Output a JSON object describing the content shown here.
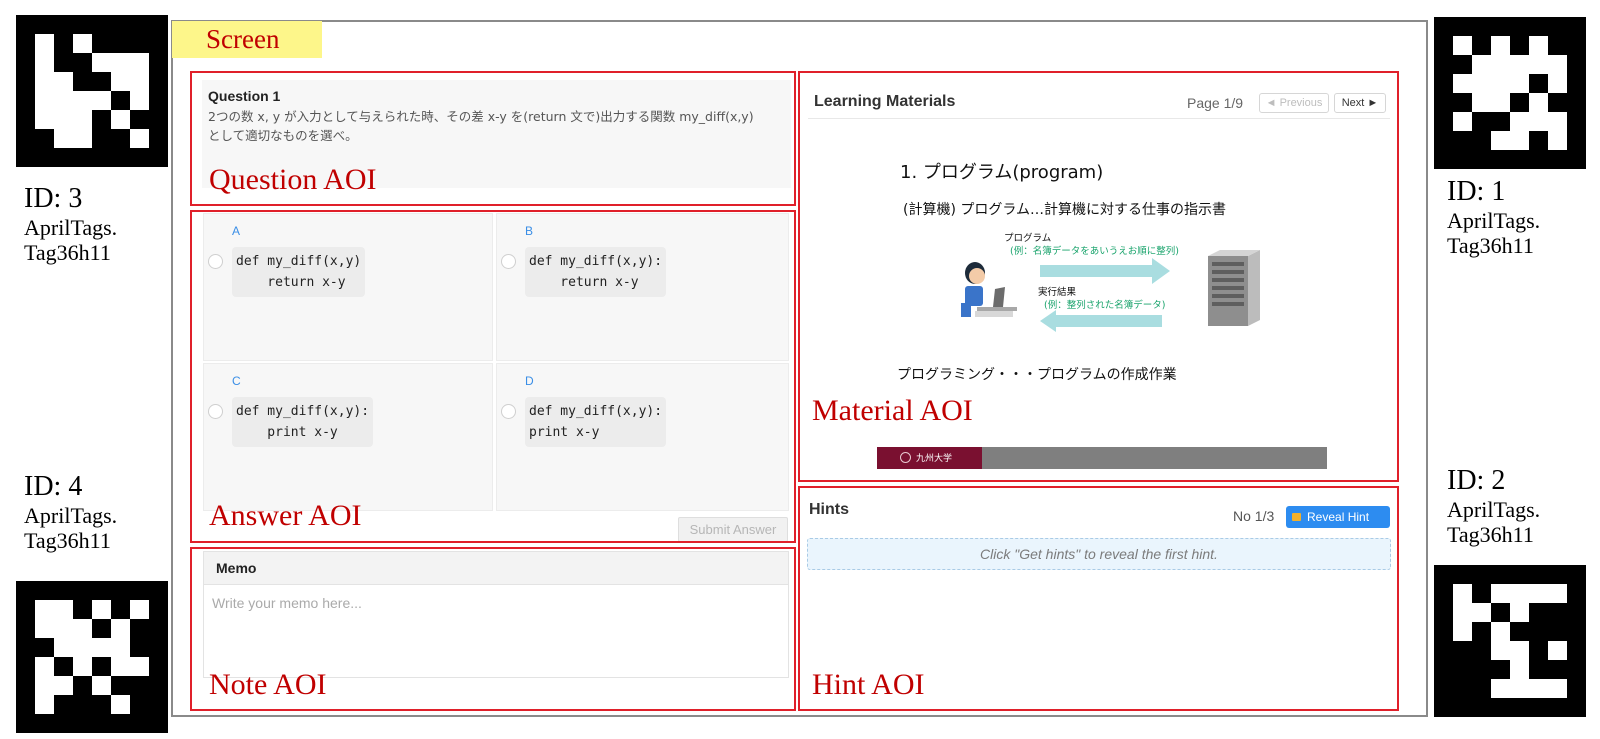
{
  "tags": [
    {
      "id_text": "ID: 3",
      "line1": "AprilTags.",
      "line2": "Tag36h11"
    },
    {
      "id_text": "ID: 4",
      "line1": "AprilTags.",
      "line2": "Tag36h11"
    },
    {
      "id_text": "ID: 1",
      "line1": "AprilTags.",
      "line2": "Tag36h11"
    },
    {
      "id_text": "ID: 2",
      "line1": "AprilTags.",
      "line2": "Tag36h11"
    }
  ],
  "screen_label": "Screen",
  "aoi_labels": {
    "question": "Question AOI",
    "answer": "Answer AOI",
    "note": "Note AOI",
    "material": "Material AOI",
    "hint": "Hint AOI"
  },
  "question": {
    "title": "Question 1",
    "text_line1": "2つの数 x, y が入力として与えられた時、その差 x-y を(return 文で)出力する関数 my_diff(x,y)",
    "text_line2": "として適切なものを選べ。"
  },
  "answers": [
    {
      "letter": "A",
      "line1": "def my_diff(x,y)",
      "line2": "    return x-y"
    },
    {
      "letter": "B",
      "line1": "def my_diff(x,y):",
      "line2": "    return x-y"
    },
    {
      "letter": "C",
      "line1": "def my_diff(x,y):",
      "line2": "    print x-y"
    },
    {
      "letter": "D",
      "line1": "def my_diff(x,y):",
      "line2": "print x-y"
    }
  ],
  "submit_label": "Submit Answer",
  "memo": {
    "title": "Memo",
    "placeholder": "Write your memo here..."
  },
  "materials": {
    "title": "Learning Materials",
    "page": "Page 1/9",
    "prev_label": "◄ Previous",
    "next_label": "Next ►",
    "slide": {
      "heading": "1.  プログラム(program)",
      "definition": "(計算機) プログラム…計算機に対する仕事の指示書",
      "arrow1_title": "プログラム",
      "arrow1_note": "(例：名簿データをあいうえお順に整列)",
      "arrow2_title": "実行結果",
      "arrow2_note": "(例：整列された名簿データ)",
      "footer_text": "プログラミング・・・プログラムの作成作業",
      "university": "九州大学"
    }
  },
  "hints": {
    "title": "Hints",
    "counter": "No 1/3",
    "reveal_label": "Reveal Hint",
    "placeholder": "Click \"Get hints\" to reveal the first hint."
  },
  "colors": {
    "aoi_border": "#e0202a",
    "aoi_label": "#c00000",
    "screen_label_bg": "#fdf68a",
    "reveal_button": "#2d8cf0"
  }
}
